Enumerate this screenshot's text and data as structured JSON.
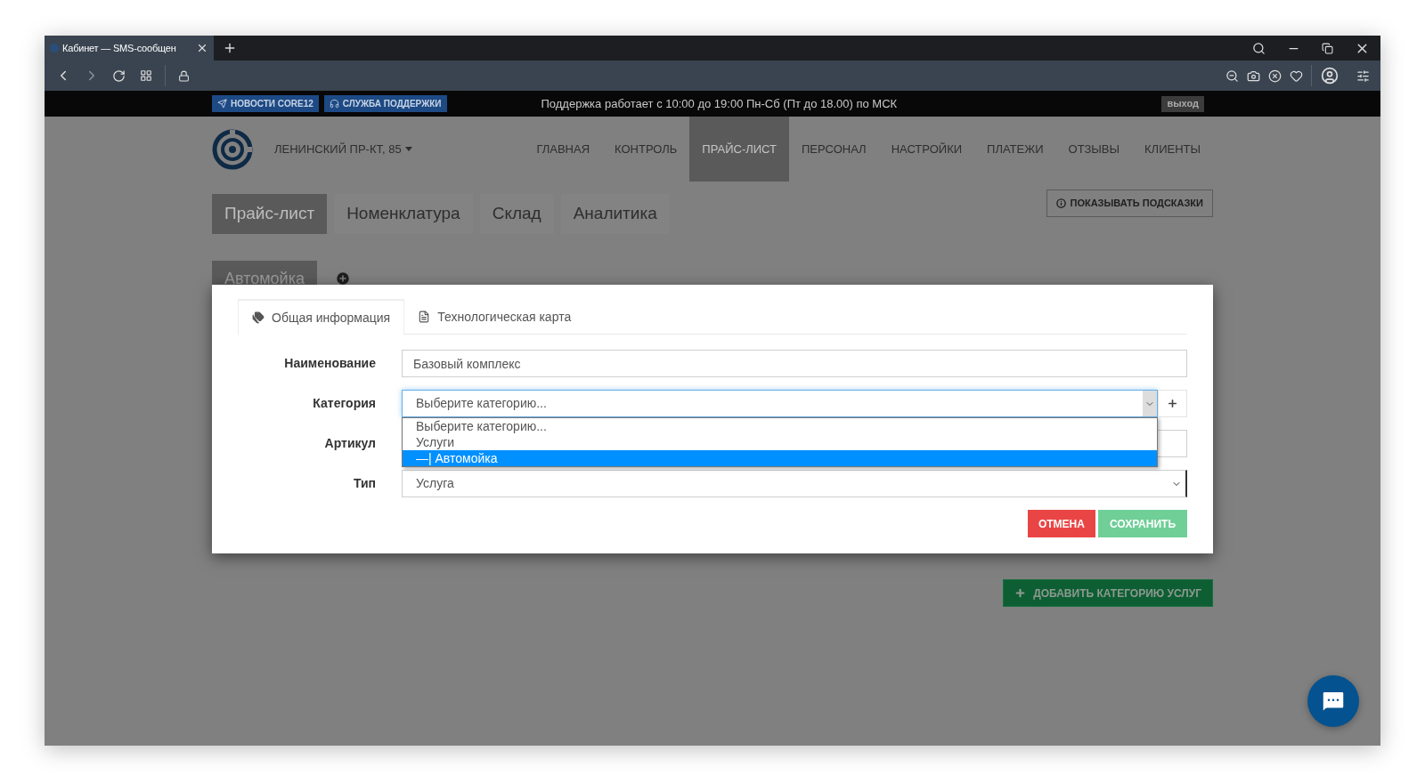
{
  "browser": {
    "tab_title": "Кабинет — SMS-сообщен"
  },
  "notice_bar": {
    "buttons": [
      {
        "label": "НОВОСТИ CORE12",
        "kind": "news"
      },
      {
        "label": "СЛУЖБА ПОДДЕРЖКИ",
        "kind": "support"
      }
    ],
    "message": "Поддержка работает с 10:00 до 19:00 Пн-Сб (Пт до 18.00) по МСК",
    "logout": "выход"
  },
  "header": {
    "location": "ЛЕНИНСКИЙ ПР-КТ, 85",
    "nav": [
      {
        "label": "ГЛАВНАЯ",
        "selected": false
      },
      {
        "label": "КОНТРОЛЬ",
        "selected": false
      },
      {
        "label": "ПРАЙС-ЛИСТ",
        "selected": true
      },
      {
        "label": "ПЕРСОНАЛ",
        "selected": false
      },
      {
        "label": "НАСТРОЙКИ",
        "selected": false
      },
      {
        "label": "ПЛАТЕЖИ",
        "selected": false
      },
      {
        "label": "ОТЗЫВЫ",
        "selected": false
      },
      {
        "label": "КЛИЕНТЫ",
        "selected": false
      }
    ]
  },
  "sub_tabs": [
    {
      "label": "Прайс-лист",
      "selected": true
    },
    {
      "label": "Номенклатура",
      "selected": false
    },
    {
      "label": "Склад",
      "selected": false
    },
    {
      "label": "Аналитика",
      "selected": false
    }
  ],
  "hints_button": "ПОКАЗЫВАТЬ ПОДСКАЗКИ",
  "category_tabs": [
    {
      "label": "Автомойка",
      "selected": true
    }
  ],
  "modal": {
    "tabs": [
      {
        "label": "Общая информация",
        "selected": true,
        "kind": "tags"
      },
      {
        "label": "Технологическая карта",
        "selected": false,
        "kind": "document"
      }
    ],
    "fields": [
      {
        "kind": "text",
        "label": "Наименование",
        "value": "Базовый комплекс"
      },
      {
        "kind": "select",
        "label": "Категория",
        "value": "Выберите категорию...",
        "add_button": true,
        "expanded": true,
        "options": [
          {
            "label": "Выберите категорию...",
            "highlighted": false
          },
          {
            "label": "Услуги",
            "highlighted": false
          },
          {
            "label": "—| Автомойка",
            "highlighted": true
          }
        ]
      },
      {
        "kind": "text",
        "label": "Артикул"
      },
      {
        "kind": "select",
        "label": "Тип",
        "value": "Услуга",
        "add_button": false,
        "expanded": false
      }
    ],
    "cancel": "ОТМЕНА",
    "save": "СОХРАНИТЬ"
  },
  "add_category_button": "ДОБАВИТЬ КАТЕГОРИЮ УСЛУГ"
}
